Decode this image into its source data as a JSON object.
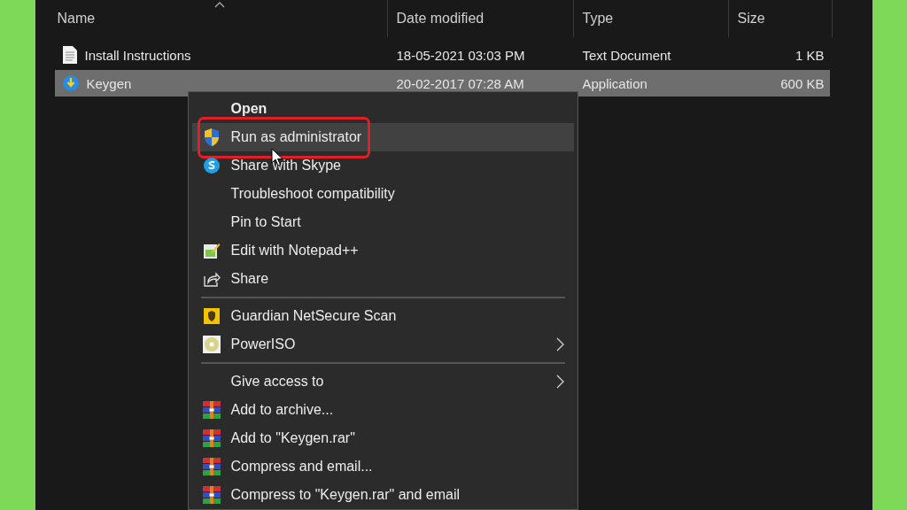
{
  "columns": [
    {
      "label": "Name",
      "sorted": true
    },
    {
      "label": "Date modified",
      "sorted": false
    },
    {
      "label": "Type",
      "sorted": false
    },
    {
      "label": "Size",
      "sorted": false
    }
  ],
  "files": [
    {
      "name": "Install Instructions",
      "date": "18-05-2021 03:03 PM",
      "type": "Text Document",
      "size": "1 KB",
      "kind": "document",
      "selected": false
    },
    {
      "name": "Keygen",
      "date": "20-02-2017 07:28 AM",
      "type": "Application",
      "size": "600 KB",
      "kind": "app",
      "selected": true
    }
  ],
  "context_menu": {
    "items": [
      {
        "kind": "plain",
        "label": "Open",
        "bold": true,
        "selected": false,
        "submenu": false,
        "outlined": false
      },
      {
        "kind": "shield",
        "label": "Run as administrator",
        "bold": false,
        "selected": true,
        "submenu": false,
        "outlined": true
      },
      {
        "kind": "skype",
        "label": "Share with Skype",
        "bold": false,
        "selected": false,
        "submenu": false,
        "outlined": false
      },
      {
        "kind": "plain",
        "label": "Troubleshoot compatibility",
        "bold": false,
        "selected": false,
        "submenu": false,
        "outlined": false
      },
      {
        "kind": "plain",
        "label": "Pin to Start",
        "bold": false,
        "selected": false,
        "submenu": false,
        "outlined": false
      },
      {
        "kind": "notepad",
        "label": "Edit with Notepad++",
        "bold": false,
        "selected": false,
        "submenu": false,
        "outlined": false
      },
      {
        "kind": "share",
        "label": "Share",
        "bold": false,
        "selected": false,
        "submenu": false,
        "outlined": false
      },
      {
        "kind": "separator"
      },
      {
        "kind": "guardian",
        "label": "Guardian NetSecure Scan",
        "bold": false,
        "selected": false,
        "submenu": false,
        "outlined": false
      },
      {
        "kind": "disc",
        "label": "PowerISO",
        "bold": false,
        "selected": false,
        "submenu": true,
        "outlined": false
      },
      {
        "kind": "separator"
      },
      {
        "kind": "plain",
        "label": "Give access to",
        "bold": false,
        "selected": false,
        "submenu": true,
        "outlined": false
      },
      {
        "kind": "archive",
        "label": "Add to archive...",
        "bold": false,
        "selected": false,
        "submenu": false,
        "outlined": false
      },
      {
        "kind": "archive",
        "label": "Add to \"Keygen.rar\"",
        "bold": false,
        "selected": false,
        "submenu": false,
        "outlined": false
      },
      {
        "kind": "archive",
        "label": "Compress and email...",
        "bold": false,
        "selected": false,
        "submenu": false,
        "outlined": false
      },
      {
        "kind": "archive",
        "label": "Compress to \"Keygen.rar\" and email",
        "bold": false,
        "selected": false,
        "submenu": false,
        "outlined": false
      }
    ]
  }
}
